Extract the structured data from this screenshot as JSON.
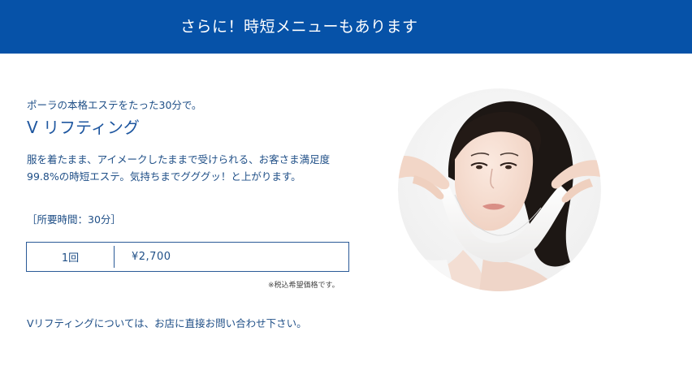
{
  "banner": {
    "title": "さらに！時短メニューもあります"
  },
  "menu": {
    "lead": "ポーラの本格エステをたった30分で。",
    "title": "V リフティング",
    "description": "服を着たまま、アイメークしたままで受けられる、お客さま満足度99.8%の時短エステ。気持ちまでグググッ！と上がります。",
    "duration": "［所要時間：30分］",
    "price": {
      "count": "1回",
      "value": "¥2,700"
    },
    "tax_note": "※税込希望価格です。",
    "contact_note": "Vリフティングについては、お店に直接お問い合わせ下さい。"
  },
  "photo": {
    "subject": "v-lifting-facial-mask-photo"
  },
  "colors": {
    "banner_bg": "#0652a8",
    "text": "#1f4f87",
    "title": "#1f57a0",
    "border": "#2a5a97"
  }
}
